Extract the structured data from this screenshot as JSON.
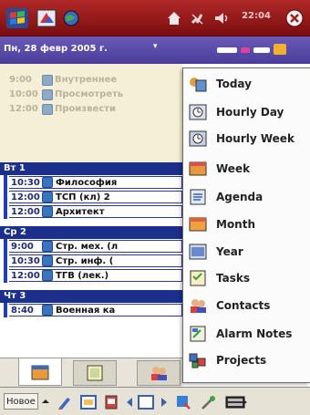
{
  "titlebar": {
    "clock": "22:04",
    "start_icon": "windows-flag-icon",
    "icons": [
      "calendar-app-icon",
      "globe-icon",
      "home-icon",
      "signal-icon",
      "volume-icon",
      "close-icon"
    ]
  },
  "datebar": {
    "date": "Пн, 28 февр 2005 г.",
    "dropdown": "▾"
  },
  "allday": [
    {
      "time": "9:00",
      "title": "Внутреннее"
    },
    {
      "time": "10:00",
      "title": "Просмотреть"
    },
    {
      "time": "12:00",
      "title": "Произвести"
    }
  ],
  "days": [
    {
      "header": "Вт 1",
      "entries": [
        {
          "time": "10:30",
          "title": "Философия"
        },
        {
          "time": "12:00",
          "title": "ТСП (кл) 2"
        },
        {
          "time": "12:00",
          "title": "Архитект"
        }
      ]
    },
    {
      "header": "Ср 2",
      "entries": [
        {
          "time": "9:00",
          "title": "Стр. мех. (л"
        },
        {
          "time": "10:30",
          "title": "Стр. инф. ("
        },
        {
          "time": "12:00",
          "title": "ТГВ (лек.)"
        }
      ]
    },
    {
      "header": "Чт 3",
      "entries": [
        {
          "time": "8:40",
          "title": "Военная ка"
        }
      ]
    }
  ],
  "menu": [
    {
      "label": "Today",
      "icon": "today-icon"
    },
    {
      "label": "Hourly Day",
      "icon": "hourly-day-icon"
    },
    {
      "label": "Hourly Week",
      "icon": "hourly-week-icon"
    },
    {
      "label": "Week",
      "icon": "week-icon"
    },
    {
      "label": "Agenda",
      "icon": "agenda-icon"
    },
    {
      "label": "Month",
      "icon": "month-icon"
    },
    {
      "label": "Year",
      "icon": "year-icon"
    },
    {
      "label": "Tasks",
      "icon": "tasks-icon"
    },
    {
      "label": "Contacts",
      "icon": "contacts-icon"
    },
    {
      "label": "Alarm Notes",
      "icon": "alarm-notes-icon"
    },
    {
      "label": "Projects",
      "icon": "projects-icon"
    }
  ],
  "tabs": [
    "calendar-tab-icon",
    "notes-tab-icon",
    "contacts-tab-icon"
  ],
  "cmdbar": {
    "new_label": "Новое",
    "icons": [
      "new-dropdown-icon",
      "pen-icon",
      "calendar-view-icon",
      "delete-icon",
      "prev-icon",
      "day-view-icon",
      "next-icon",
      "find-icon",
      "tools-icon",
      "keyboard-icon"
    ]
  },
  "colors": {
    "titlebar": "#9c1f1f",
    "datebar": "#5a4cac",
    "day_header": "#1c2f8a",
    "allday_bg": "#f4efd6"
  }
}
